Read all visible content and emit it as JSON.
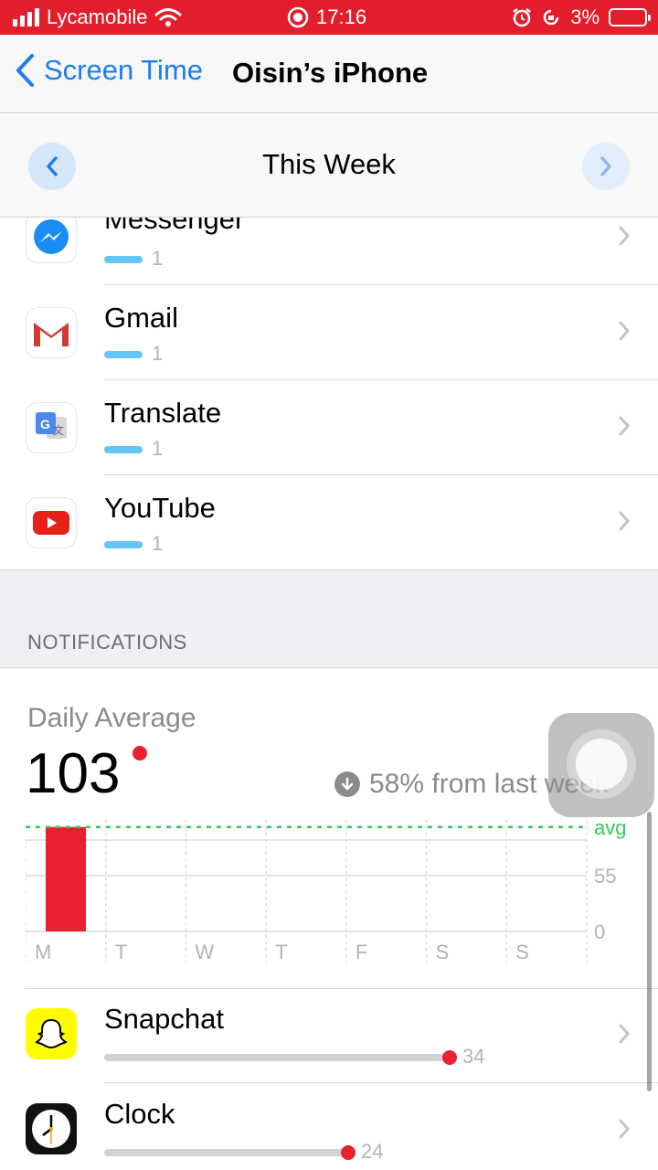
{
  "status": {
    "carrier": "Lycamobile",
    "time": "17:16",
    "battery": "3%"
  },
  "nav": {
    "back_label": "Screen Time",
    "title": "Oisin’s iPhone"
  },
  "week": {
    "title": "This Week"
  },
  "apps": [
    {
      "name": "Messenger",
      "value": "1"
    },
    {
      "name": "Gmail",
      "value": "1"
    },
    {
      "name": "Translate",
      "value": "1"
    },
    {
      "name": "YouTube",
      "value": "1"
    }
  ],
  "section": {
    "notifications": "NOTIFICATIONS"
  },
  "notifications": {
    "daily_average_label": "Daily Average",
    "daily_average": "103",
    "delta_text": "58% from last week"
  },
  "chart_data": {
    "type": "bar",
    "categories": [
      "M",
      "T",
      "W",
      "T",
      "F",
      "S",
      "S"
    ],
    "values": [
      103,
      0,
      0,
      0,
      0,
      0,
      0
    ],
    "ylim": [
      0,
      110
    ],
    "yticks": [
      {
        "label": "0",
        "value": 0
      },
      {
        "label": "55",
        "value": 55
      },
      {
        "label": "avg",
        "value": 103
      }
    ],
    "avg": 103,
    "colors": {
      "bar": "#e8202f",
      "avg_line": "#34c759"
    }
  },
  "notif_apps": [
    {
      "name": "Snapchat",
      "count": "34",
      "fraction": 1.0
    },
    {
      "name": "Clock",
      "count": "24",
      "fraction": 0.706
    }
  ],
  "icons": [
    "wifi-icon",
    "record-icon",
    "alarm-icon",
    "orientation-lock-icon",
    "battery-icon",
    "back-chevron-icon",
    "chevron-left-icon",
    "chevron-right-icon",
    "messenger-icon",
    "gmail-icon",
    "translate-icon",
    "youtube-icon",
    "arrow-down-icon",
    "snapchat-icon",
    "clock-icon",
    "assistive-touch-icon"
  ]
}
